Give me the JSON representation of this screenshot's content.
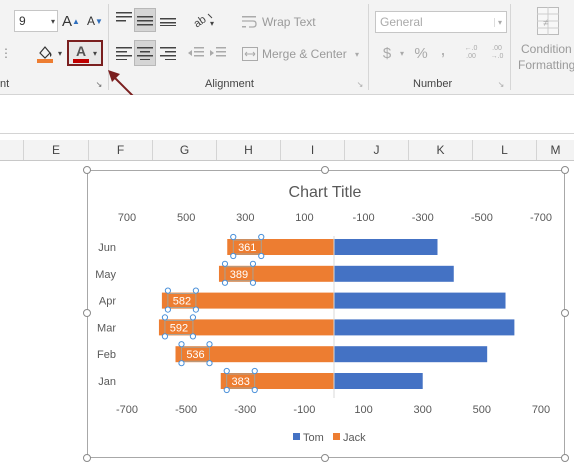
{
  "ribbon": {
    "font_size": "9",
    "grow_font_icon": "A",
    "shrink_font_icon": "A",
    "font_color_icon": "A",
    "wrap_text": "Wrap Text",
    "merge_center": "Merge & Center",
    "number_format": "General",
    "currency_symbol": "$",
    "percent_symbol": "%",
    "comma_symbol": ",",
    "inc_decimal": "←.0 .00",
    "dec_decimal": ".00 →.0",
    "conditional_formatting_line1": "Condition",
    "conditional_formatting_line2": "Formatting",
    "groups": {
      "font_tail": "nt",
      "alignment": "Alignment",
      "number": "Number"
    },
    "highlight_color": "#7a1f1f",
    "font_color_bar": "#c00000",
    "fill_color_bar": "#ed7d31"
  },
  "columns": [
    "E",
    "F",
    "G",
    "H",
    "I",
    "J",
    "K",
    "L",
    "M"
  ],
  "chart_data": {
    "type": "bar",
    "title": "Chart Title",
    "categories": [
      "Jan",
      "Feb",
      "Mar",
      "Apr",
      "May",
      "Jun"
    ],
    "series": [
      {
        "name": "Tom",
        "color": "#4472c4",
        "values": [
          300,
          518,
          610,
          580,
          405,
          350
        ]
      },
      {
        "name": "Jack",
        "color": "#ed7d31",
        "values": [
          383,
          536,
          592,
          582,
          389,
          361
        ]
      }
    ],
    "top_axis_ticks": [
      "700",
      "500",
      "300",
      "100",
      "-100",
      "-300",
      "-500",
      "-700"
    ],
    "bottom_axis_ticks": [
      "-700",
      "-500",
      "-300",
      "-100",
      "100",
      "300",
      "500",
      "700"
    ],
    "xlim": [
      -700,
      700
    ],
    "legend_position": "bottom",
    "data_labels": [
      "383",
      "536",
      "592",
      "582",
      "389",
      "361"
    ]
  }
}
